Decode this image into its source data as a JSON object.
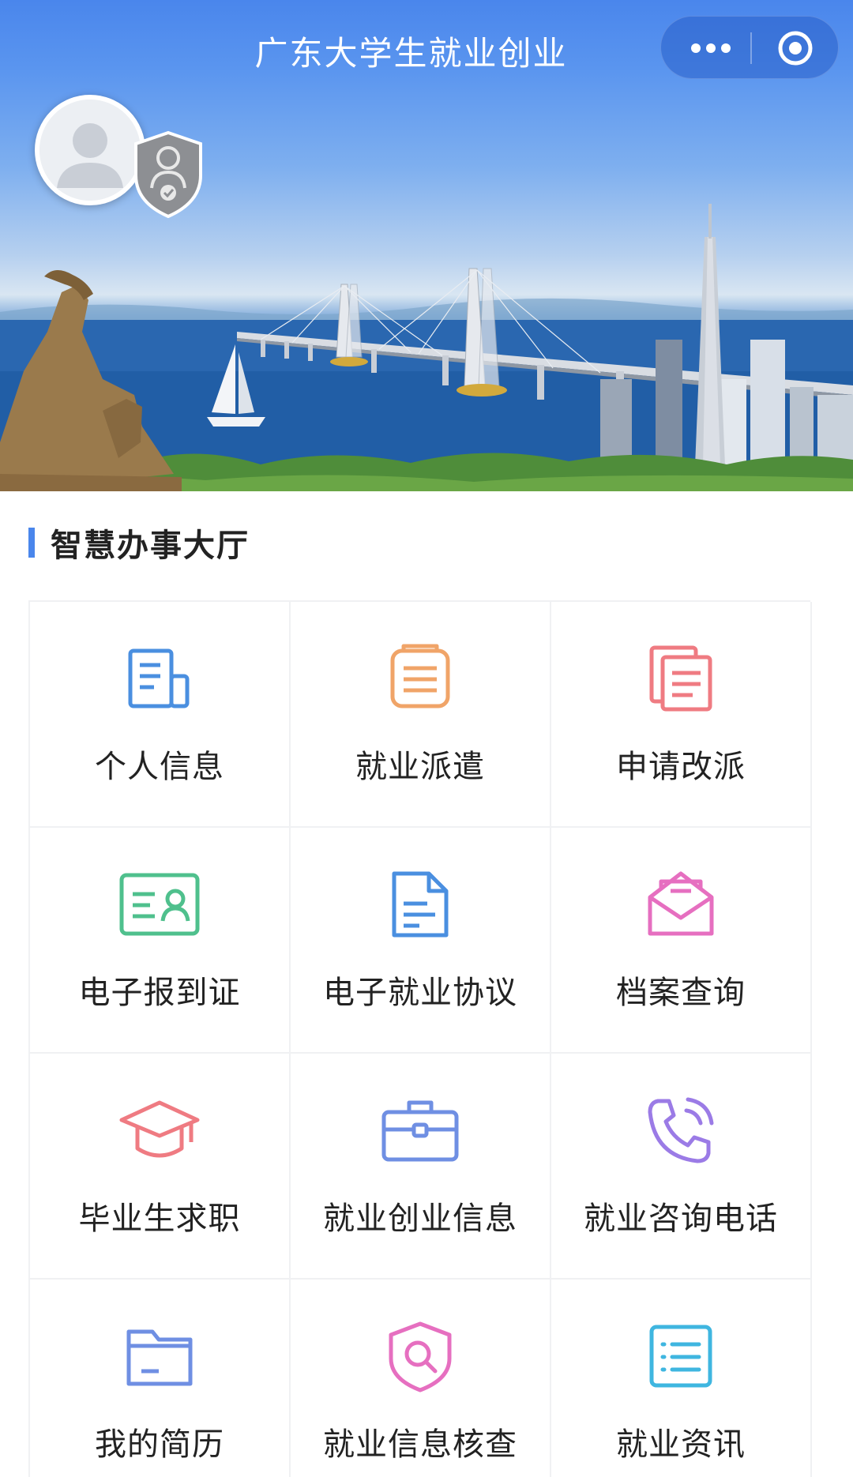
{
  "header": {
    "title": "广东大学生就业创业",
    "more_icon": "more-dots-icon",
    "close_icon": "target-close-icon"
  },
  "profile": {
    "avatar_icon": "default-avatar-icon",
    "badge_icon": "verified-shield-badge-icon"
  },
  "section": {
    "title": "智慧办事大厅",
    "accent": "#4a86ec"
  },
  "services": [
    {
      "label": "个人信息",
      "icon": "personal-info-icon",
      "color": "#4a8fe0"
    },
    {
      "label": "就业派遣",
      "icon": "dispatch-document-icon",
      "color": "#f0a468"
    },
    {
      "label": "申请改派",
      "icon": "reassign-documents-icon",
      "color": "#ef7b82"
    },
    {
      "label": "电子报到证",
      "icon": "id-card-icon",
      "color": "#4fc08d"
    },
    {
      "label": "电子就业协议",
      "icon": "agreement-file-icon",
      "color": "#4a8fe0"
    },
    {
      "label": "档案查询",
      "icon": "envelope-icon",
      "color": "#e66fc0"
    },
    {
      "label": "毕业生求职",
      "icon": "graduation-cap-icon",
      "color": "#ef7b82"
    },
    {
      "label": "就业创业信息",
      "icon": "briefcase-icon",
      "color": "#6f8fe3"
    },
    {
      "label": "就业咨询电话",
      "icon": "phone-icon",
      "color": "#9b7be6"
    },
    {
      "label": "我的简历",
      "icon": "folder-icon",
      "color": "#6f8fe3"
    },
    {
      "label": "就业信息核查",
      "icon": "shield-search-icon",
      "color": "#e66fc0"
    },
    {
      "label": "就业资讯",
      "icon": "news-list-icon",
      "color": "#3fb6e0"
    }
  ]
}
